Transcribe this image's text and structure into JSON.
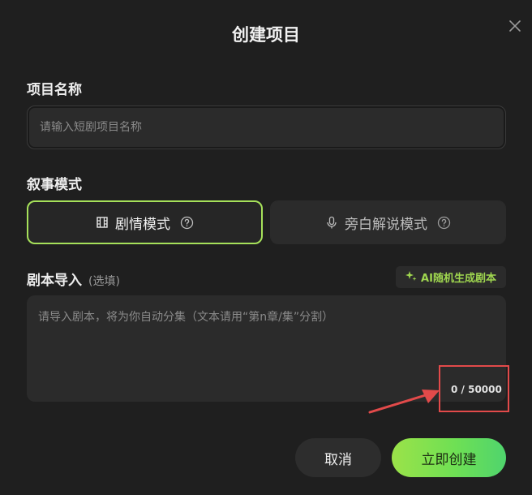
{
  "dialog": {
    "title": "创建项目"
  },
  "project_name": {
    "label": "项目名称",
    "value": "",
    "placeholder": "请输入短剧项目名称"
  },
  "narrative": {
    "label": "叙事模式",
    "modes": [
      {
        "label": "剧情模式",
        "icon": "film-icon",
        "selected": true
      },
      {
        "label": "旁白解说模式",
        "icon": "microphone-icon",
        "selected": false
      }
    ]
  },
  "script": {
    "label": "剧本导入",
    "optional": "(选填)",
    "ai_button": "AI随机生成剧本",
    "value": "",
    "placeholder": "请导入剧本，将为你自动分集（文本请用“第n章/集”分割）",
    "counter": "0 / 50000"
  },
  "actions": {
    "cancel": "取消",
    "create": "立即创建"
  },
  "colors": {
    "accent": "#a6e15a",
    "background": "#1f1f1f",
    "field": "#2b2b2b",
    "annotation": "#e24a4a"
  }
}
